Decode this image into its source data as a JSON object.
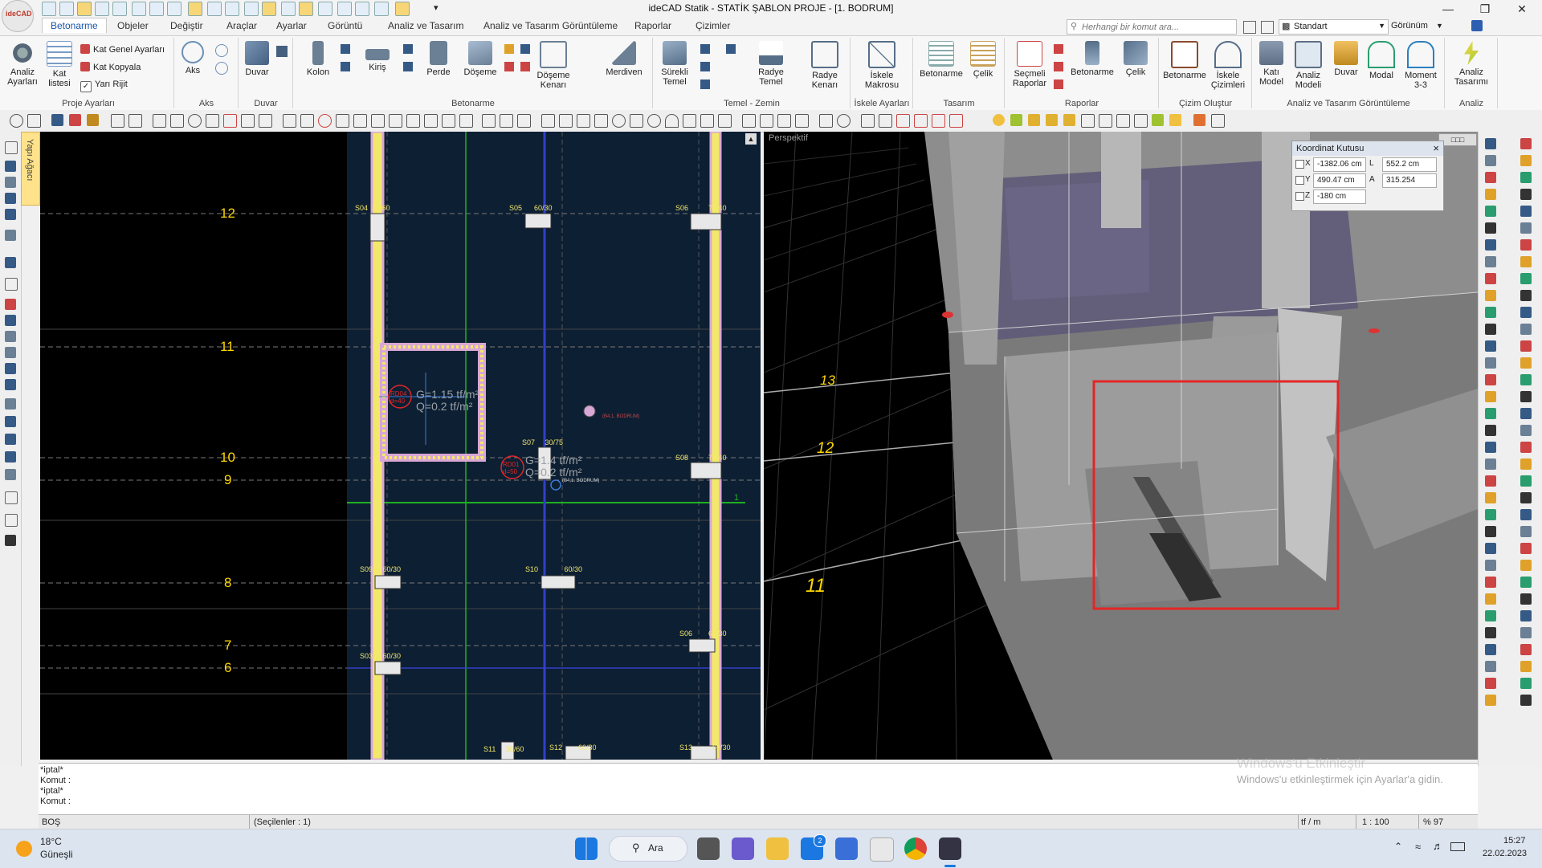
{
  "app": {
    "logo_text": "ideCAD",
    "title": "ideCAD Statik - STATİK ŞABLON PROJE - [1. BODRUM]",
    "quick_access_dropdown": "▾"
  },
  "ribbon_tabs": [
    "Betonarme",
    "Objeler",
    "Değiştir",
    "Araçlar",
    "Ayarlar",
    "Görüntü",
    "Analiz ve Tasarım",
    "Analiz ve Tasarım Görüntüleme",
    "Raporlar",
    "Çizimler"
  ],
  "search": {
    "placeholder": "Herhangi bir komut ara..."
  },
  "style_select": {
    "value": "Standart"
  },
  "view_menu": {
    "label": "Görünüm"
  },
  "ribbon_groups": [
    {
      "label": "Proje Ayarları",
      "buttons": [
        "Analiz Ayarları",
        "Kat listesi"
      ],
      "small": [
        "Kat Genel Ayarları",
        "Kat Kopyala",
        "Yarı Rijit"
      ]
    },
    {
      "label": "Aks",
      "buttons": [
        "Aks"
      ]
    },
    {
      "label": "Duvar",
      "buttons": [
        "Duvar"
      ]
    },
    {
      "label": "Betonarme",
      "buttons": [
        "Kolon",
        "Kiriş",
        "Perde",
        "Döşeme",
        "Döşeme Kenarı",
        "Merdiven"
      ]
    },
    {
      "label": "Temel - Zemin",
      "buttons": [
        "Sürekli Temel",
        "Radye Temel",
        "Radye Kenarı"
      ]
    },
    {
      "label": "İskele Ayarları",
      "buttons": [
        "İskele Makrosu"
      ]
    },
    {
      "label": "Tasarım",
      "buttons": [
        "Betonarme",
        "Çelik"
      ]
    },
    {
      "label": "Raporlar",
      "buttons": [
        "Seçmeli Raporlar",
        "Betonarme",
        "Çelik"
      ]
    },
    {
      "label": "Çizim Oluştur",
      "buttons": [
        "Betonarme",
        "İskele Çizimleri"
      ]
    },
    {
      "label": "Analiz ve Tasarım Görüntüleme",
      "buttons": [
        "Katı Model",
        "Analiz Modeli",
        "Duvar",
        "Modal",
        "Moment 3-3"
      ]
    },
    {
      "label": "Analiz",
      "buttons": [
        "Analiz Tasarımı"
      ]
    }
  ],
  "tree_tab": {
    "label": "Yapı Ağacı"
  },
  "plan": {
    "axis_labels": [
      "12",
      "11",
      "10",
      "9",
      "8",
      "7",
      "6"
    ],
    "columns": [
      {
        "id": "S04",
        "size": "30/60"
      },
      {
        "id": "S05",
        "size": "60/30"
      },
      {
        "id": "S06",
        "size": "70/40"
      },
      {
        "id": "S07",
        "size": "30/75"
      },
      {
        "id": "S08",
        "size": "70/40"
      },
      {
        "id": "S09",
        "size": "60/30"
      },
      {
        "id": "S10",
        "size": "60/30"
      },
      {
        "id": "S06",
        "size": "60/30"
      },
      {
        "id": "S03",
        "size": "60/30"
      },
      {
        "id": "S11",
        "size": "30/60"
      },
      {
        "id": "S12",
        "size": "60/30"
      },
      {
        "id": "S13",
        "size": "60/30"
      }
    ],
    "slab_rd04": {
      "name": "RD04",
      "d": "d=40",
      "g": "G=1.15 tf/m²",
      "q": "Q=0.2 tf/m²"
    },
    "slab_rd01": {
      "name": "RD01",
      "d": "d=50",
      "g": "G=1.4 tf/m²",
      "q": "Q=0.2 tf/m²"
    },
    "floor_tag": "(B4,1. BODRUM)",
    "axis_one": "1"
  },
  "perspective": {
    "label": "Perspektif",
    "axis_labels": [
      "13",
      "12",
      "11"
    ]
  },
  "coord_box": {
    "title": "Koordinat Kutusu",
    "x": "-1382.06 cm",
    "y": "490.47 cm",
    "z": "-180 cm",
    "l": "552.2 cm",
    "a": "315.254",
    "x_label": "X",
    "y_label": "Y",
    "z_label": "Z",
    "l_label": "L",
    "a_label": "A",
    "close": "×"
  },
  "command_log": [
    "*iptal*",
    "Komut :",
    "*iptal*",
    "Komut :"
  ],
  "status": {
    "mode": "BOŞ",
    "selected": "(Seçilenler : 1)",
    "unit": "tf / m",
    "scale": "1 : 100",
    "zoom": "% 97"
  },
  "watermark": {
    "line1": "Windows'u Etkinleştir",
    "line2": "Windows'u etkinleştirmek için Ayarlar'a gidin."
  },
  "taskbar": {
    "weather_temp": "18°C",
    "weather_desc": "Güneşli",
    "search_label": "Ara",
    "time": "15:27",
    "date": "22.02.2023",
    "mail_badge": "2"
  },
  "colors": {
    "plan_bg": "#000000",
    "dark_panel": "#0d1f33",
    "wall": "#d9a7d6",
    "wall_fill": "#f2e86a",
    "axis_label": "#ffd700",
    "selection_red": "#e32626",
    "blue_beam": "#3340c8",
    "green_line": "#20b020"
  }
}
